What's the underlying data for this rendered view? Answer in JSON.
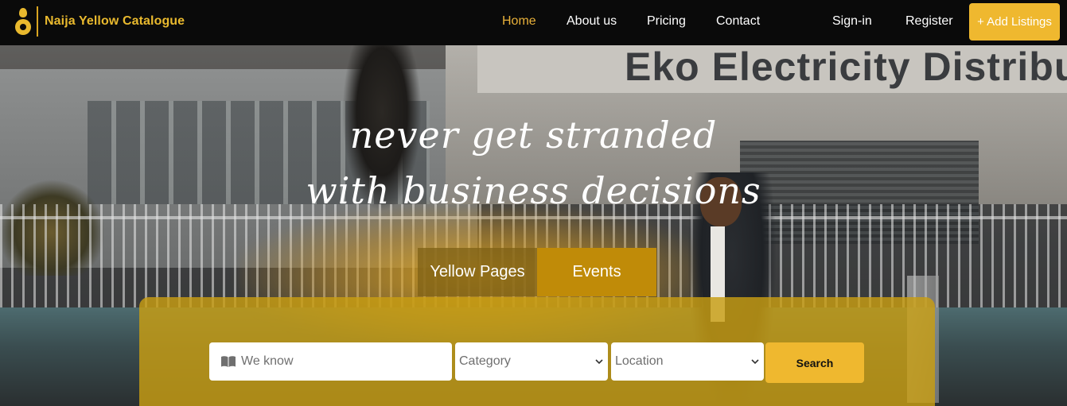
{
  "brand": {
    "name": "Naija Yellow Catalogue",
    "accent": "#efb82f"
  },
  "nav": {
    "home": "Home",
    "about": "About us",
    "pricing": "Pricing",
    "contact": "Contact",
    "signin": "Sign-in",
    "register": "Register",
    "add_listing": "+ Add Listings"
  },
  "hero": {
    "headline_line1": "never get stranded",
    "headline_line2": "with business decisions",
    "background_sign": "Eko Electricity Distribu"
  },
  "tabs": [
    {
      "label": "Yellow Pages",
      "active": false
    },
    {
      "label": "Events",
      "active": true
    }
  ],
  "search": {
    "keyword_value": "We know",
    "keyword_icon": "book-icon",
    "category_value": "Category",
    "location_value": "Location",
    "button_label": "Search"
  }
}
